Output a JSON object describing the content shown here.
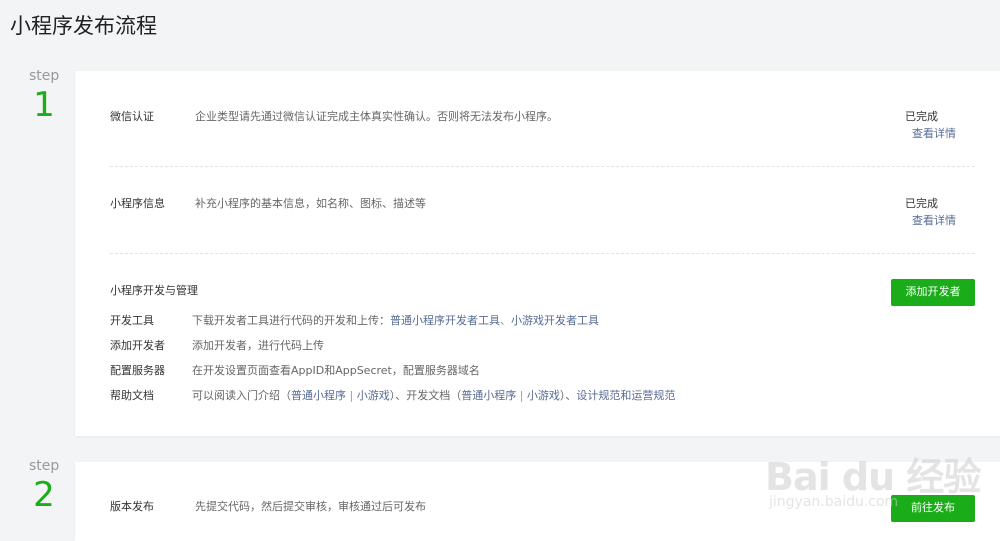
{
  "page": {
    "title": "小程序发布流程"
  },
  "step1": {
    "label": "step",
    "number": "1",
    "rows": [
      {
        "label": "微信认证",
        "desc": "企业类型请先通过微信认证完成主体真实性确认。否则将无法发布小程序。",
        "status": "已完成",
        "link": "查看详情"
      },
      {
        "label": "小程序信息",
        "desc": "补充小程序的基本信息，如名称、图标、描述等",
        "status": "已完成",
        "link": "查看详情"
      }
    ],
    "dev": {
      "title": "小程序开发与管理",
      "button": "添加开发者",
      "tools": {
        "label": "开发工具",
        "desc": "下载开发者工具进行代码的开发和上传：",
        "link1": "普通小程序开发者工具",
        "sep": "、",
        "link2": "小游戏开发者工具"
      },
      "add_dev": {
        "label": "添加开发者",
        "desc": "添加开发者，进行代码上传"
      },
      "server": {
        "label": "配置服务器",
        "desc": "在开发设置页面查看AppID和AppSecret，配置服务器域名"
      },
      "help": {
        "label": "帮助文档",
        "desc_a": "可以阅读入门介绍（",
        "link_a1": "普通小程序",
        "bar": " | ",
        "link_a2": "小游戏",
        "desc_b": "）、开发文档（",
        "link_b1": "普通小程序",
        "link_b2": "小游戏",
        "desc_c": "）、",
        "link_c": "设计规范和运营规范"
      }
    }
  },
  "step2": {
    "label": "step",
    "number": "2",
    "row": {
      "label": "版本发布",
      "desc": "先提交代码，然后提交审核，审核通过后可发布",
      "button": "前往发布"
    }
  },
  "watermark": {
    "text": "Bai du 经验",
    "sub": "jingyan.baidu.com"
  },
  "colors": {
    "accent": "#1aad19",
    "link": "#576b95",
    "background": "#f3f4f5"
  }
}
